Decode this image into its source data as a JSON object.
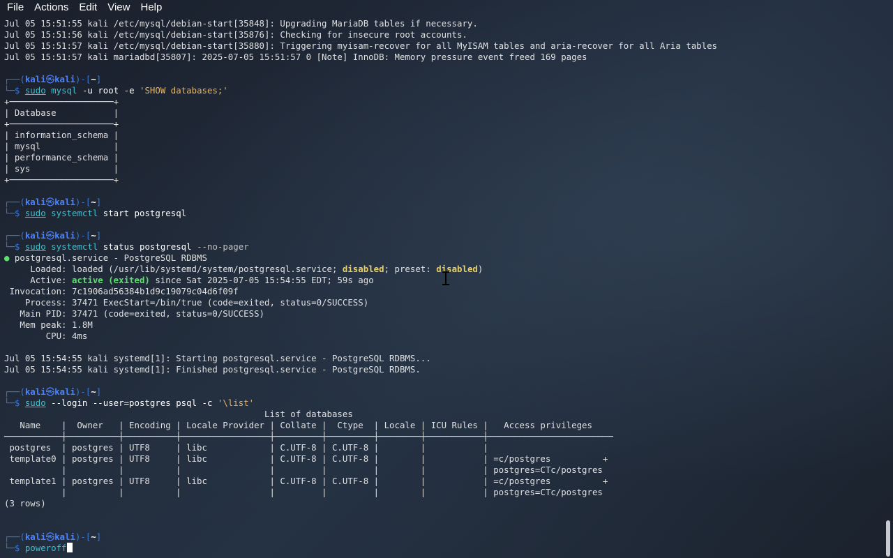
{
  "menu": {
    "file": "File",
    "actions": "Actions",
    "edit": "Edit",
    "view": "View",
    "help": "Help"
  },
  "prompt": {
    "user": "kali",
    "host": "kali",
    "skull": "㉿",
    "path": "~"
  },
  "log_top": [
    "Jul 05 15:51:55 kali /etc/mysql/debian-start[35848]: Upgrading MariaDB tables if necessary.",
    "Jul 05 15:51:56 kali /etc/mysql/debian-start[35876]: Checking for insecure root accounts.",
    "Jul 05 15:51:57 kali /etc/mysql/debian-start[35880]: Triggering myisam-recover for all MyISAM tables and aria-recover for all Aria tables",
    "Jul 05 15:51:57 kali mariadbd[35807]: 2025-07-05 15:51:57 0 [Note] InnoDB: Memory pressure event freed 169 pages"
  ],
  "cmd1": {
    "sudo": "sudo",
    "bin": "mysql",
    "args": "-u root -e",
    "str": "'SHOW databases;'"
  },
  "mysql_table": {
    "header": "Database",
    "rows": [
      "information_schema",
      "mysql",
      "performance_schema",
      "sys"
    ]
  },
  "cmd2": {
    "sudo": "sudo",
    "bin": "systemctl",
    "args": "start postgresql"
  },
  "cmd3": {
    "sudo": "sudo",
    "bin": "systemctl",
    "args": "status postgresql",
    "opt": "--no-pager"
  },
  "status": {
    "bullet": "●",
    "service": "postgresql.service - PostgreSQL RDBMS",
    "loaded_label": "     Loaded:",
    "loaded_pre": "loaded (/usr/lib/systemd/system/postgresql.service;",
    "loaded_disabled": "disabled",
    "loaded_mid": "; preset:",
    "loaded_preset": "disabled",
    "loaded_end": ")",
    "active_label": "     Active:",
    "active_state": "active (exited)",
    "active_rest": "since Sat 2025-07-05 15:54:55 EDT; 59s ago",
    "invocation": " Invocation: 7c1906ad56384b1d9c19079c04d6f09f",
    "process": "    Process: 37471 ExecStart=/bin/true (code=exited, status=0/SUCCESS)",
    "main_pid": "   Main PID: 37471 (code=exited, status=0/SUCCESS)",
    "mem_peak": "   Mem peak: 1.8M",
    "cpu": "        CPU: 4ms"
  },
  "log_mid": [
    "Jul 05 15:54:55 kali systemd[1]: Starting postgresql.service - PostgreSQL RDBMS...",
    "Jul 05 15:54:55 kali systemd[1]: Finished postgresql.service - PostgreSQL RDBMS."
  ],
  "cmd4": {
    "sudo": "sudo",
    "args": "--login --user=postgres psql -c",
    "str": "'\\list'"
  },
  "pg_table": {
    "title": "List of databases",
    "columns": [
      "Name",
      "Owner",
      "Encoding",
      "Locale Provider",
      "Collate",
      "Ctype",
      "Locale",
      "ICU Rules",
      "Access privileges"
    ],
    "rows": [
      [
        "postgres",
        "postgres",
        "UTF8",
        "libc",
        "C.UTF-8",
        "C.UTF-8",
        "",
        "",
        ""
      ],
      [
        "template0",
        "postgres",
        "UTF8",
        "libc",
        "C.UTF-8",
        "C.UTF-8",
        "",
        "",
        "=c/postgres          +\npostgres=CTc/postgres"
      ],
      [
        "template1",
        "postgres",
        "UTF8",
        "libc",
        "C.UTF-8",
        "C.UTF-8",
        "",
        "",
        "=c/postgres          +\npostgres=CTc/postgres"
      ]
    ],
    "footer": "(3 rows)"
  },
  "cmd5": {
    "bin": "poweroff"
  }
}
